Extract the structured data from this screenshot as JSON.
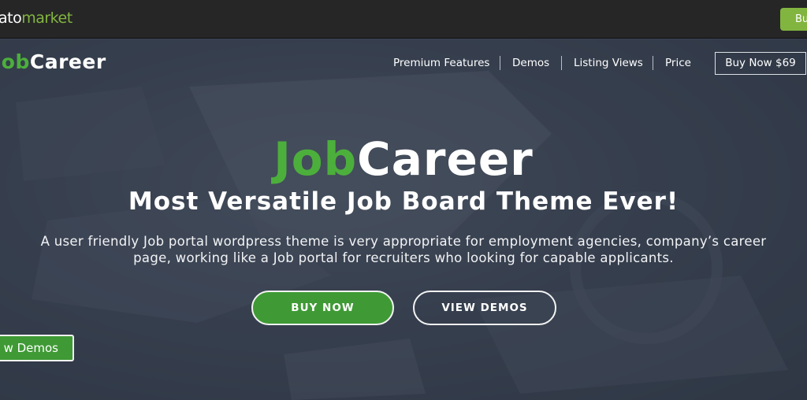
{
  "topbar": {
    "logo_prefix": "ato",
    "logo_suffix": "market",
    "buy_label": "Bu"
  },
  "nav": {
    "brand_green": "Job",
    "brand_white": "Career",
    "items": [
      {
        "label": "Premium Features"
      },
      {
        "label": "Demos"
      },
      {
        "label": "Listing Views"
      },
      {
        "label": "Price"
      }
    ],
    "buy_label": "Buy Now $69"
  },
  "hero": {
    "title_green": "Job",
    "title_white": "Career",
    "subtitle": "Most Versatile Job Board Theme Ever!",
    "description": "A user friendly Job portal wordpress theme is very appropriate for employment agencies, company’s career page, working like a Job portal for recruiters who looking for capable applicants.",
    "buy_button": "BUY NOW",
    "demos_button": "VIEW DEMOS",
    "side_button": "w Demos"
  },
  "colors": {
    "brand_green": "#4caf3c",
    "envato_green": "#82b540",
    "topbar_bg": "#262626",
    "hero_overlay": "#3b4352"
  }
}
